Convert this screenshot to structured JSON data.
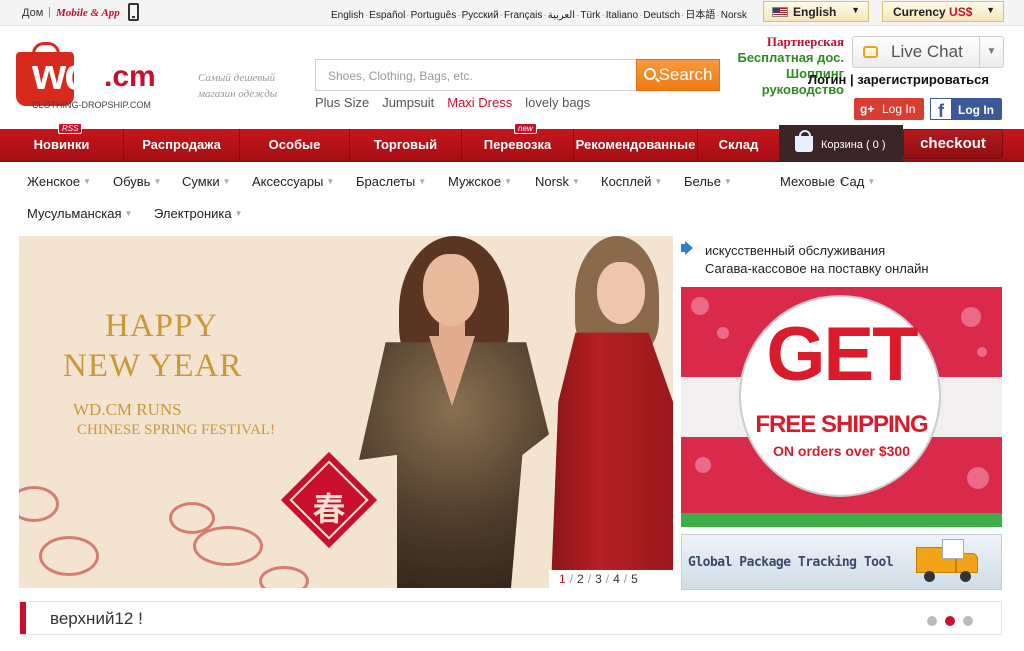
{
  "topbar": {
    "home": "Дом",
    "separator": "|",
    "mobile_app": "Mobile & App",
    "languages": [
      "English",
      "Español",
      "Português",
      "Русский",
      "Français",
      "العربية",
      "Türk",
      "Italiano",
      "Deutsch",
      "日本語",
      "Norsk"
    ],
    "language_select": "English",
    "currency_label": "Currency",
    "currency_value": "US$"
  },
  "header": {
    "logo_main": "wd",
    "logo_tld": ".cm",
    "logo_sub": "CLOTHING-DROPSHIP.COM",
    "tagline": "Самый дешевый магазин одежды",
    "search_placeholder": "Shoes, Clothing, Bags, etc.",
    "search_button": "Search",
    "hot_searches": [
      {
        "label": "Plus Size",
        "highlight": false
      },
      {
        "label": "Jumpsuit",
        "highlight": false
      },
      {
        "label": "Maxi Dress",
        "highlight": true
      },
      {
        "label": "lovely bags",
        "highlight": false
      }
    ],
    "partner_lines": [
      "Партнерская",
      "Бесплатная дос.",
      "Шоппинг руководство"
    ],
    "live_chat": "Live Chat",
    "login": "Логин",
    "login_sep": "|",
    "register": "зарегистрироваться",
    "google_icon": "g+",
    "google_login": "Log In",
    "facebook_icon": "f",
    "facebook_login": "Log In"
  },
  "nav": {
    "items": [
      {
        "label": "Новинки",
        "badge": "RSS"
      },
      {
        "label": "Распродажа",
        "badge": ""
      },
      {
        "label": "Особые",
        "badge": ""
      },
      {
        "label": "Торговый",
        "badge": ""
      },
      {
        "label": "Перевозка",
        "badge": "new"
      },
      {
        "label": "Рекомендованные",
        "badge": ""
      },
      {
        "label": "Склад",
        "badge": ""
      }
    ],
    "cart": "Корзина ( 0 )",
    "checkout": "checkout"
  },
  "categories": {
    "row1": [
      "Женское",
      "Обувь",
      "Сумки",
      "Аксессуары",
      "Браслеты",
      "Мужское",
      "Norsk",
      "Косплей",
      "Белье",
      "Меховые",
      "Сад"
    ],
    "row2": [
      "Мусульманская",
      "Электроника"
    ]
  },
  "banner": {
    "line1": "HAPPY",
    "line2": "NEW YEAR",
    "line3": "WD.CM RUNS",
    "line4": "CHINESE SPRING FESTIVAL!",
    "seal_char": "春",
    "slides": [
      "1",
      "2",
      "3",
      "4",
      "5"
    ],
    "slide_sep": "/",
    "current_slide": 1
  },
  "notice": {
    "line1": "искусственный обслуживания",
    "line2": "Сагава-кассовое на поставку онлайн"
  },
  "promo": {
    "headline": "GET",
    "subline": "FREE SHIPPING",
    "note": "ON orders over $300"
  },
  "tracking": {
    "label": "Global Package Tracking Tool"
  },
  "section": {
    "title": "верхний12 !",
    "pager_count": 3,
    "pager_active": 2
  },
  "colors": {
    "brand_red": "#c8102e",
    "nav_red": "#b41218",
    "search_orange": "#f07c14",
    "partner_green": "#2c8c1d",
    "google_red": "#d73d32",
    "facebook_blue": "#3b5998"
  },
  "icons": [
    "phone-icon",
    "flag-us-icon",
    "search-icon",
    "chat-bubble-icon",
    "speaker-icon",
    "shopping-bag-icon",
    "truck-icon"
  ]
}
